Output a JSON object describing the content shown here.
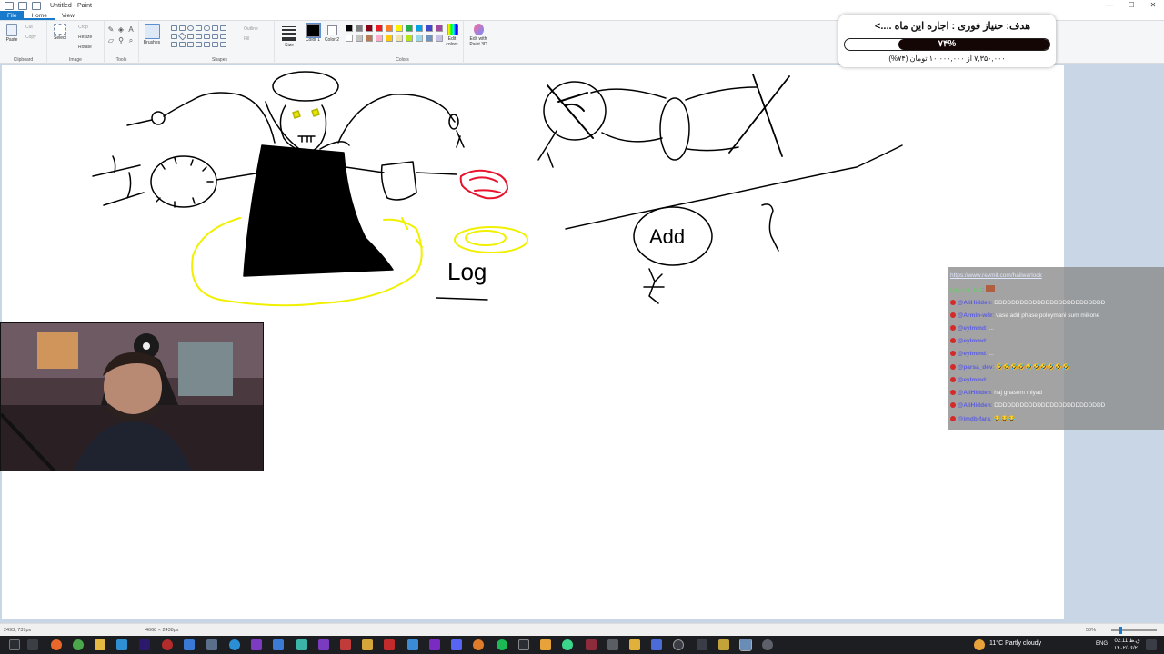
{
  "window": {
    "title": "Untitled - Paint",
    "controls": [
      "—",
      "☐",
      "✕"
    ]
  },
  "tabs": [
    {
      "label": "File"
    },
    {
      "label": "Home"
    },
    {
      "label": "View"
    }
  ],
  "ribbon": {
    "clipboard": {
      "name": "Clipboard",
      "paste": "Paste",
      "cut": "Cut",
      "copy": "Copy"
    },
    "image": {
      "name": "Image",
      "select": "Select",
      "crop": "Crop",
      "resize": "Resize",
      "rotate": "Rotate"
    },
    "tools": {
      "name": "Tools"
    },
    "brushes": {
      "label": "Brushes"
    },
    "shapes": {
      "name": "Shapes",
      "outline": "Outline",
      "fill": "Fill"
    },
    "size": {
      "label": "Size"
    },
    "color1": {
      "label": "Color 1"
    },
    "color2": {
      "label": "Color 2"
    },
    "colors": {
      "name": "Colors"
    },
    "edit_colors": {
      "label": "Edit colors"
    },
    "paint3d": {
      "label": "Edit with Paint 3D"
    }
  },
  "palette": [
    "#000000",
    "#7f7f7f",
    "#880015",
    "#ed1c24",
    "#ff7f27",
    "#fff200",
    "#22b14c",
    "#00a2e8",
    "#3f48cc",
    "#a349a4",
    "#ffffff",
    "#c3c3c3",
    "#b97a57",
    "#ffaec9",
    "#ffc90e",
    "#efe4b0",
    "#b5e61d",
    "#99d9ea",
    "#7092be",
    "#c8bfe7"
  ],
  "donation_goal": {
    "title": "هدف: حنیاز فوری : اجاره این ماه ....>",
    "percent_label": "۷۴%",
    "progress": 0.74,
    "amount_text": "۷,۳۵۰,۰۰۰ از ۱۰,۰۰۰,۰۰۰ تومان (۷۴%)"
  },
  "canvas_text": {
    "log": "Log",
    "add": "Add"
  },
  "chat": {
    "link": "https://www.revmit.com/hailwarlock",
    "messages": [
      {
        "user": "Legion_111",
        "text": ""
      },
      {
        "user": "@AliHidden",
        "text": "DDDDDDDDDDDDDDDDDDDDDDDDDD"
      },
      {
        "user": "@Armin-w8r",
        "text": "vase add phase poleymani sum mikone"
      },
      {
        "user": "@eylmmd",
        "text": "..."
      },
      {
        "user": "@eylmmd",
        "text": "..."
      },
      {
        "user": "@eylmmd",
        "text": "..."
      },
      {
        "user": "@parsa_dev",
        "text": "🤣🤣🤣🤣🤣🤣🤣🤣🤣🤣"
      },
      {
        "user": "@eylmmd",
        "text": "..."
      },
      {
        "user": "@AliHidden",
        "text": "haj ghasem miyad"
      },
      {
        "user": "@AliHidden",
        "text": "DDDDDDDDDDDDDDDDDDDDDDDDDD"
      },
      {
        "user": "@imdb-fara",
        "text": "😂😂😂"
      }
    ]
  },
  "status_bar": {
    "cursor_pos": "2493, 737px",
    "canvas_size": "4668 × 2438px",
    "zoom": "50%"
  },
  "taskbar": {
    "weather": "11°C  Partly cloudy",
    "language": "ENG",
    "time": "02:11 ق.ظ",
    "date": "۱۴۰۲/۰۶/۲۰"
  }
}
